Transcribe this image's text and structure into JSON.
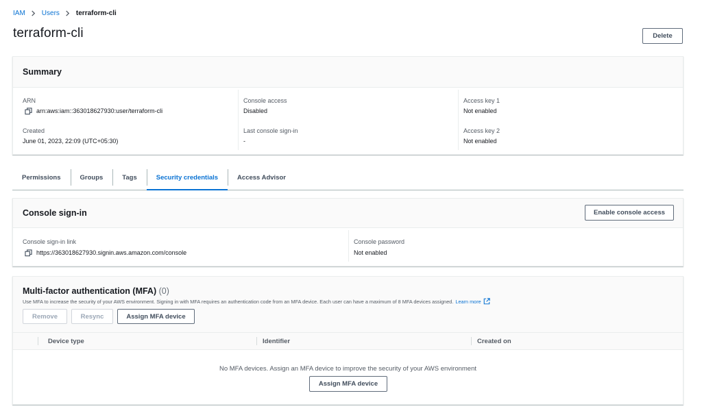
{
  "breadcrumb": {
    "root": "IAM",
    "parent": "Users",
    "current": "terraform-cli"
  },
  "page": {
    "title": "terraform-cli",
    "delete_label": "Delete"
  },
  "summary": {
    "title": "Summary",
    "arn": {
      "label": "ARN",
      "value": "arn:aws:iam::363018627930:user/terraform-cli"
    },
    "created": {
      "label": "Created",
      "value": "June 01, 2023, 22:09 (UTC+05:30)"
    },
    "console_access": {
      "label": "Console access",
      "value": "Disabled"
    },
    "last_sign_in": {
      "label": "Last console sign-in",
      "value": "-"
    },
    "access_key_1": {
      "label": "Access key 1",
      "value": "Not enabled"
    },
    "access_key_2": {
      "label": "Access key 2",
      "value": "Not enabled"
    }
  },
  "tabs": [
    {
      "label": "Permissions"
    },
    {
      "label": "Groups"
    },
    {
      "label": "Tags"
    },
    {
      "label": "Security credentials",
      "active": true
    },
    {
      "label": "Access Advisor"
    }
  ],
  "console_signin": {
    "title": "Console sign-in",
    "enable_label": "Enable console access",
    "link": {
      "label": "Console sign-in link",
      "value": "https://363018627930.signin.aws.amazon.com/console"
    },
    "password": {
      "label": "Console password",
      "value": "Not enabled"
    }
  },
  "mfa": {
    "title": "Multi-factor authentication (MFA)",
    "count": "(0)",
    "description": "Use MFA to increase the security of your AWS environment. Signing in with MFA requires an authentication code from an MFA device. Each user can have a maximum of 8 MFA devices assigned.",
    "learn_more": "Learn more",
    "remove_label": "Remove",
    "resync_label": "Resync",
    "assign_label": "Assign MFA device",
    "columns": [
      "Device type",
      "Identifier",
      "Created on"
    ],
    "empty_text": "No MFA devices. Assign an MFA device to improve the security of your AWS environment",
    "empty_assign_label": "Assign MFA device"
  },
  "colors": {
    "link": "#0972d3",
    "text": "#16191f",
    "muted": "#545b64",
    "border": "#eaeded"
  },
  "icons": {
    "copy": "copy-icon",
    "external": "external-link-icon",
    "breadcrumb_separator": "chevron-right-icon"
  }
}
